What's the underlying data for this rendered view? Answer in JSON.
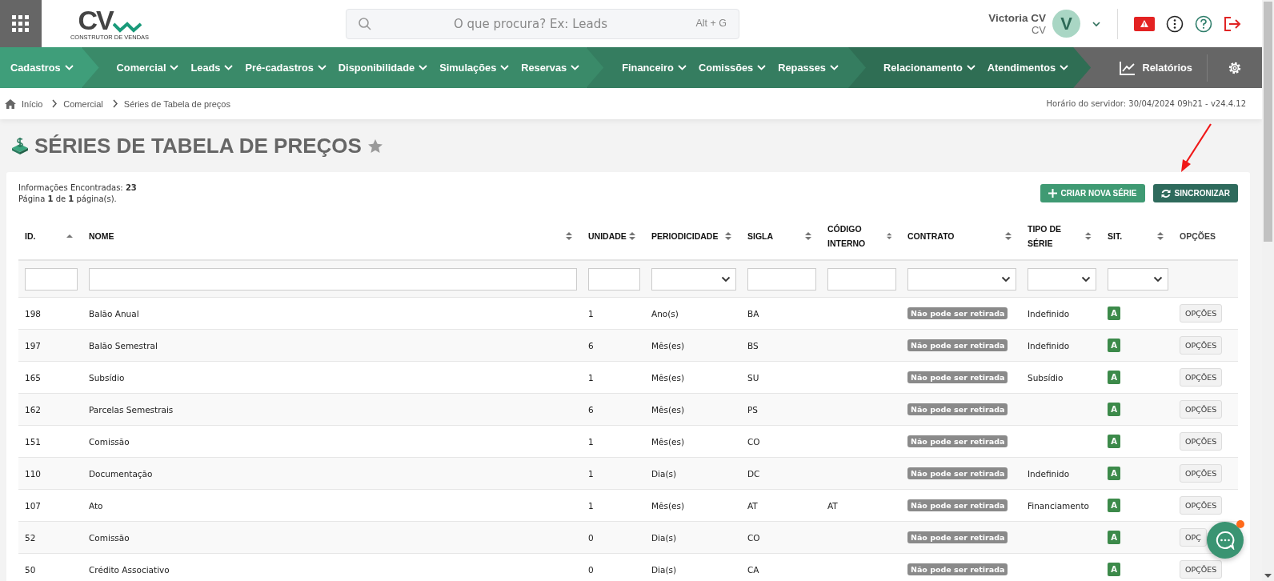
{
  "header": {
    "logo": {
      "text": "CV",
      "tagline": "CONSTRUTOR DE VENDAS"
    },
    "search": {
      "placeholder": "O que procura? Ex: Leads",
      "shortcut": "Alt + G"
    },
    "user": {
      "name": "Victoria CV",
      "company": "CV",
      "initial": "V"
    }
  },
  "nav": {
    "groups": [
      {
        "color": "#3f9e7a",
        "items": [
          "Cadastros"
        ]
      },
      {
        "color": "#3a8a69",
        "items": [
          "Comercial",
          "Leads",
          "Pré-cadastros",
          "Disponibilidade",
          "Simulações",
          "Reservas"
        ]
      },
      {
        "color": "#357d60",
        "items": [
          "Financeiro",
          "Comissões",
          "Repasses"
        ]
      },
      {
        "color": "#2f6e54",
        "items": [
          "Relacionamento",
          "Atendimentos"
        ]
      }
    ],
    "reports": "Relatórios"
  },
  "breadcrumb": [
    "Início",
    "Comercial",
    "Séries de Tabela de preços"
  ],
  "server_time": "Horário do servidor: 30/04/2024 09h21 - v24.4.12",
  "page": {
    "title": "SÉRIES DE TABELA DE PREÇOS",
    "favorite": false
  },
  "summary": {
    "found_label": "Informações Encontradas:",
    "found": "23",
    "page_line": "Página **1** de **1** página(s)."
  },
  "buttons": [
    {
      "kind": "create",
      "label": "CRIAR NOVA SÉRIE"
    },
    {
      "kind": "sync",
      "label": "SINCRONIZAR"
    }
  ],
  "table": {
    "columns": [
      {
        "label": "ID.",
        "sortable": true,
        "sorted": true,
        "filter": {
          "kind": "text"
        }
      },
      {
        "label": "NOME",
        "sortable": true,
        "sorted": false,
        "filter": {
          "kind": "text"
        }
      },
      {
        "label": "UNIDADE",
        "sortable": true,
        "sorted": false,
        "filter": {
          "kind": "text"
        }
      },
      {
        "label": "PERIODICIDADE",
        "sortable": true,
        "sorted": false,
        "filter": {
          "kind": "dropdown"
        }
      },
      {
        "label": "SIGLA",
        "sortable": true,
        "sorted": false,
        "filter": {
          "kind": "text"
        }
      },
      {
        "label": "CÓDIGO INTERNO",
        "sortable": true,
        "sorted": false,
        "filter": {
          "kind": "text"
        }
      },
      {
        "label": "CONTRATO",
        "sortable": true,
        "sorted": false,
        "filter": {
          "kind": "dropdown"
        }
      },
      {
        "label": "TIPO DE SÉRIE",
        "sortable": true,
        "sorted": false,
        "filter": {
          "kind": "dropdown"
        }
      },
      {
        "label": "SIT.",
        "sortable": true,
        "sorted": false,
        "filter": {
          "kind": "dropdown"
        }
      },
      {
        "label": "OPÇÕES"
      }
    ],
    "rows": [
      {
        "id": "198",
        "name": "Balão Anual",
        "unit": "1",
        "period": "Ano(s)",
        "code": "BA",
        "internal": "",
        "contract": "Não pode ser retirada",
        "type": "Indefinido",
        "status": "A",
        "options": "OPÇÕES"
      },
      {
        "id": "197",
        "name": "Balão Semestral",
        "unit": "6",
        "period": "Mês(es)",
        "code": "BS",
        "internal": "",
        "contract": "Não pode ser retirada",
        "type": "Indefinido",
        "status": "A",
        "options": "OPÇÕES"
      },
      {
        "id": "165",
        "name": "Subsídio",
        "unit": "1",
        "period": "Mês(es)",
        "code": "SU",
        "internal": "",
        "contract": "Não pode ser retirada",
        "type": "Subsídio",
        "status": "A",
        "options": "OPÇÕES"
      },
      {
        "id": "162",
        "name": "Parcelas Semestrais",
        "unit": "6",
        "period": "Mês(es)",
        "code": "PS",
        "internal": "",
        "contract": "Não pode ser retirada",
        "type": "",
        "status": "A",
        "options": "OPÇÕES"
      },
      {
        "id": "151",
        "name": "Comissão",
        "unit": "1",
        "period": "Mês(es)",
        "code": "CO",
        "internal": "",
        "contract": "Não pode ser retirada",
        "type": "",
        "status": "A",
        "options": "OPÇÕES"
      },
      {
        "id": "110",
        "name": "Documentação",
        "unit": "1",
        "period": "Dia(s)",
        "code": "DC",
        "internal": "",
        "contract": "Não pode ser retirada",
        "type": "Indefinido",
        "status": "A",
        "options": "OPÇÕES"
      },
      {
        "id": "107",
        "name": "Ato",
        "unit": "1",
        "period": "Mês(es)",
        "code": "AT",
        "internal": "AT",
        "contract": "Não pode ser retirada",
        "type": "Financiamento",
        "status": "A",
        "options": "OPÇÕES"
      },
      {
        "id": "52",
        "name": "Comissão",
        "unit": "0",
        "period": "Dia(s)",
        "code": "CO",
        "internal": "",
        "contract": "Não pode ser retirada",
        "type": "",
        "status": "A",
        "options": "OPÇ"
      },
      {
        "id": "50",
        "name": "Crédito Associativo",
        "unit": "0",
        "period": "Dia(s)",
        "code": "CA",
        "internal": "",
        "contract": "Não pode ser retirada",
        "type": "",
        "status": "A",
        "options": "OPÇÕES"
      }
    ]
  },
  "chat": {
    "unread": true
  }
}
